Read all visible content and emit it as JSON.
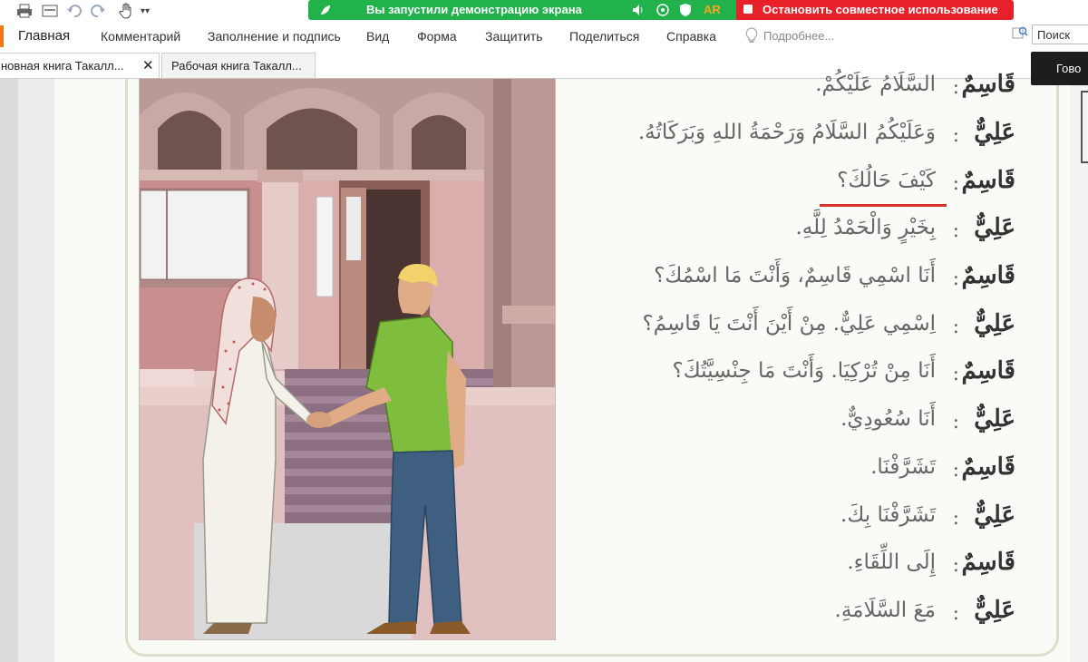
{
  "toolbar": {
    "icons": [
      "print-icon",
      "screen-icon",
      "undo-icon",
      "redo-icon",
      "hand-tool-icon",
      "customize-icon"
    ]
  },
  "share_bar": {
    "status_text": "Вы запустили демонстрацию экрана",
    "lang_badge": "AR",
    "stop_label": "Остановить совместное использование",
    "green_color": "#22b24c",
    "red_color": "#e8202a"
  },
  "ribbon": {
    "home": "Главная",
    "items": [
      "Комментарий",
      "Заполнение и подпись",
      "Вид",
      "Форма",
      "Защитить",
      "Поделиться",
      "Справка"
    ],
    "tell_me": "Подробнее...",
    "search_label": "Поиск",
    "accent_color": "#f07a1b"
  },
  "tabs": [
    {
      "label": "новная книга Такалл...",
      "active": true
    },
    {
      "label": "Рабочая книга Такалл...",
      "active": false
    }
  ],
  "tooltip": {
    "text": "Гово"
  },
  "dialogue": [
    {
      "speaker": "قَاسِمٌ",
      "text": "السَّلَامُ عَلَيْكُمْ."
    },
    {
      "speaker": "عَلِيٌّ",
      "text": "وَعَلَيْكُمُ السَّلَامُ وَرَحْمَةُ اللهِ وَبَرَكَاتُهُ."
    },
    {
      "speaker": "قَاسِمٌ",
      "text": "كَيْفَ حَالُكَ؟"
    },
    {
      "speaker": "عَلِيٌّ",
      "text": "بِخَيْرٍ وَالْحَمْدُ لِلَّهِ."
    },
    {
      "speaker": "قَاسِمٌ",
      "text": "أَنَا اسْمِي قَاسِمٌ، وَأَنْتَ مَا اسْمُكَ؟"
    },
    {
      "speaker": "عَلِيٌّ",
      "text": "اِسْمِي عَلِيٌّ. مِنْ أَيْنَ أَنْتَ يَا قَاسِمُ؟"
    },
    {
      "speaker": "قَاسِمٌ",
      "text": "أَنَا مِنْ تُرْكِيَا. وَأَنْتَ مَا جِنْسِيَّتُكَ؟"
    },
    {
      "speaker": "عَلِيٌّ",
      "text": "أَنَا سُعُودِيٌّ."
    },
    {
      "speaker": "قَاسِمٌ",
      "text": "تَشَرَّفْنَا."
    },
    {
      "speaker": "عَلِيٌّ",
      "text": "تَشَرَّفْنَا بِكَ."
    },
    {
      "speaker": "قَاسِمٌ",
      "text": "إِلَى اللِّقَاءِ."
    },
    {
      "speaker": "عَلِيٌّ",
      "text": "مَعَ السَّلَامَةِ."
    }
  ],
  "colon": ":"
}
